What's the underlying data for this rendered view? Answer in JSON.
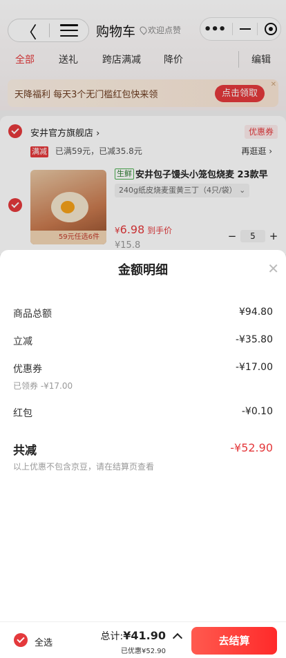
{
  "header": {
    "back_icon": "chevron-left-icon",
    "menu_icon": "hamburger-icon",
    "title": "购物车",
    "welcome": "欢迎点赞",
    "capsule": {
      "more_icon": "more-dots-icon",
      "minimize_icon": "minus-icon",
      "close_icon": "target-icon"
    }
  },
  "tabs": {
    "items": [
      {
        "label": "全部",
        "active": true
      },
      {
        "label": "送礼",
        "active": false
      },
      {
        "label": "跨店满减",
        "active": false
      },
      {
        "label": "降价",
        "active": false
      }
    ],
    "edit": "编辑"
  },
  "banner": {
    "text": "天降福利 每天3个无门槛红包快来领",
    "button": "点击领取"
  },
  "store": {
    "name": "安井官方旗舰店 ›",
    "coupon": "优惠券",
    "promo_tag": "满减",
    "promo_text": "已满59元，已减35.8元",
    "promo_more": "再逛逛 ›",
    "item": {
      "fresh_tag": "生鲜",
      "title": "安井包子馒头小笼包烧麦 23款早",
      "spec": "240g纸皮烧麦蛋黄三丁（4只/袋） ⌄",
      "image_badge": "59元任选6件",
      "price_symbol": "¥",
      "price": "6.98",
      "price_note": "到手价",
      "orig_price": "¥15.8",
      "qty": "5"
    }
  },
  "sheet": {
    "title": "金额明细",
    "rows": [
      {
        "label": "商品总额",
        "value": "¥94.80"
      },
      {
        "label": "立减",
        "value": "-¥35.80"
      },
      {
        "label": "优惠券",
        "value": "-¥17.00",
        "sub": "已领券 -¥17.00"
      },
      {
        "label": "红包",
        "value": "-¥0.10"
      }
    ],
    "total": {
      "label": "共减",
      "value": "-¥52.90"
    },
    "footnote": "以上优惠不包含京豆，请在结算页查看"
  },
  "bottom": {
    "select_all": "全选",
    "total_label": "总计:",
    "total_value": "¥41.90",
    "saved": "已优惠¥52.90",
    "checkout": "去结算"
  },
  "colors": {
    "accent": "#e4393c",
    "checkout_start": "#ff5a4f",
    "checkout_end": "#ff2a2a"
  }
}
